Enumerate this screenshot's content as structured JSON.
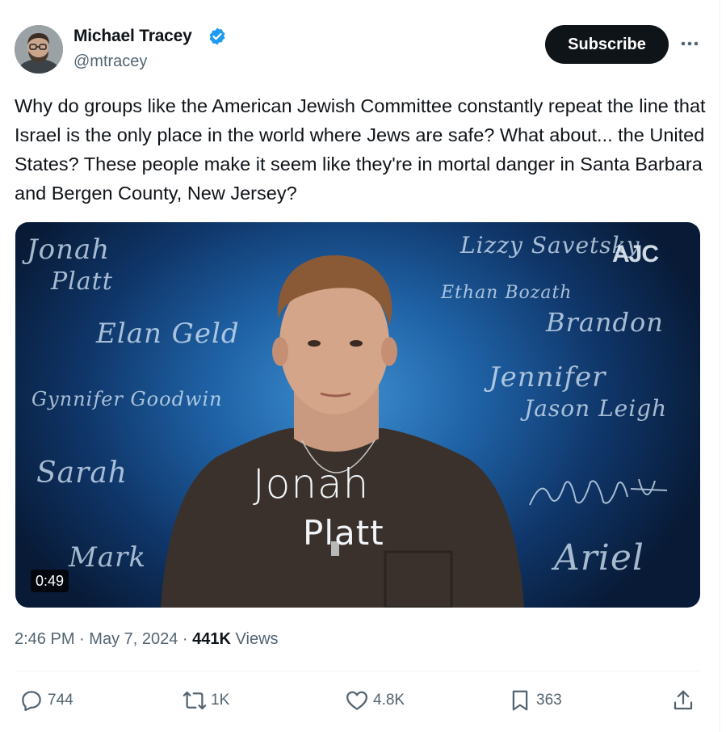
{
  "author": {
    "name": "Michael Tracey",
    "handle": "@mtracey",
    "verified": true
  },
  "header": {
    "subscribe_label": "Subscribe",
    "more_icon": "ellipsis-icon"
  },
  "tweet": {
    "text": "Why do groups like the American Jewish Committee constantly repeat the line that Israel is the only place in the world where Jews are safe? What about... the United States? These people make it seem like they're in mortal danger in Santa Barbara and Bergen County, New Jersey?"
  },
  "media": {
    "duration": "0:49",
    "brand": "AJC",
    "signatures": {
      "jonah_top": "Jonah",
      "platt_top": "Platt",
      "elan": "Elan Geld",
      "gynnifer": "Gynnifer Goodwin",
      "sarah": "Sarah",
      "mark": "Mark",
      "lizzy": "Lizzy Savetsky",
      "ethan": "Ethan Bozath",
      "brandon": "Brandon",
      "jennifer": "Jennifer",
      "jason": "Jason Leigh",
      "ariel": "Ariel",
      "center_first": "Jonah",
      "center_last": "Platt"
    }
  },
  "meta": {
    "time": "2:46 PM",
    "separator": "·",
    "date": "May 7, 2024",
    "views_count": "441K",
    "views_label": "Views"
  },
  "actions": {
    "replies": "744",
    "reposts": "1K",
    "likes": "4.8K",
    "bookmarks": "363"
  },
  "colors": {
    "text": "#0f1419",
    "secondary": "#536471",
    "verified": "#1d9bf0",
    "button": "#0f1419"
  }
}
